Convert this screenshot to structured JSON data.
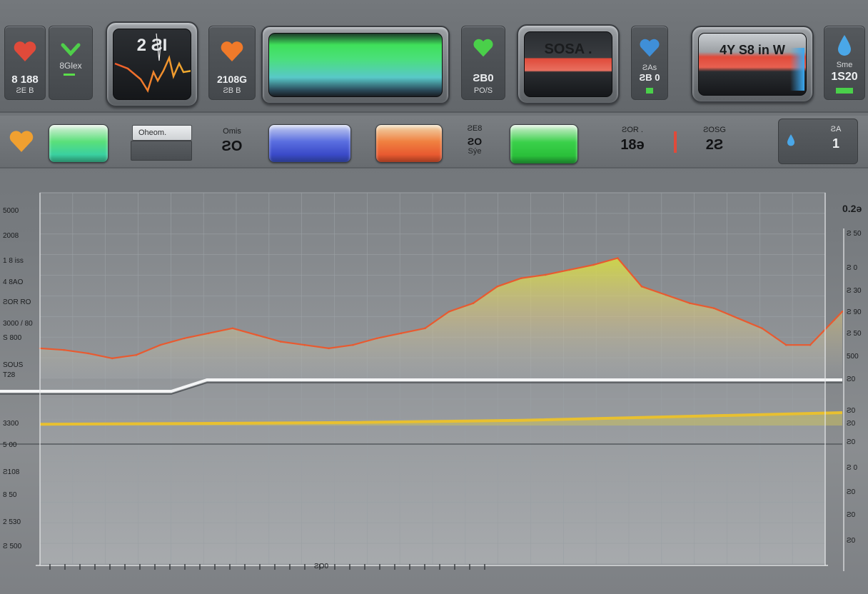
{
  "top": {
    "tiles": [
      {
        "name": "heart",
        "icon": "heart-icon",
        "color": "#e04a3a",
        "value": "8 188",
        "sub": "ƧE B"
      },
      {
        "name": "check",
        "icon": "checkmark-icon",
        "color": "#4fcf4a",
        "value": "",
        "sub": "8Glex"
      },
      {
        "name": "heart-orange",
        "icon": "heart-icon",
        "color": "#f07a2a",
        "value": "2108G",
        "sub": "ƧB B"
      },
      {
        "name": "heart-green",
        "icon": "heart-icon",
        "color": "#4ad04a",
        "value": "ƧB0",
        "sub": "PO/S"
      },
      {
        "name": "heart-blue",
        "icon": "heart-icon",
        "color": "#3f8fd8",
        "value": "ƧB 0",
        "sub": "ƧAs"
      },
      {
        "name": "drop-blue",
        "icon": "drop-icon",
        "color": "#4aa7e8",
        "value": "1S20",
        "sub": "Sme"
      }
    ],
    "screens": {
      "ecg": "2 ƧI",
      "sosa": "SOSA .",
      "right": "4Y S8 in W"
    }
  },
  "mid": {
    "input_value": "Oheom.",
    "cells": [
      {
        "a": "Omis",
        "b": "ƧO",
        "c": ""
      },
      {
        "a": "ƧE8",
        "b": "ƧO",
        "c": "Sýe"
      },
      {
        "a": "ƧOR .",
        "b": "18ə",
        "c": ""
      },
      {
        "a": "ƧOSG",
        "b": "2Ƨ",
        "c": ""
      },
      {
        "a": "ƧA",
        "b": "1",
        "c": ""
      }
    ]
  },
  "chart_data": {
    "type": "area",
    "title": "",
    "top_right_label": "0.2ə",
    "left_ticks": [
      "5000",
      "2008",
      "1 8 iss",
      "4 8AO",
      "ƧOR RO",
      "3000 / 80",
      "S 800",
      "SOUS",
      "T28",
      "3300",
      "5 00",
      "Ƨ108",
      "8 50",
      "2 530",
      "Ƨ 500"
    ],
    "right_ticks": [
      "Ƨ 50",
      "Ƨ 0",
      "Ƨ 30",
      "Ƨ 90",
      "Ƨ 50",
      "500",
      "Ƨ0",
      "Ƨ0",
      "Ƨ0",
      "Ƨ0",
      "Ƨ 0",
      "Ƨ0",
      "Ƨ0",
      "Ƨ0"
    ],
    "bottom_label": "ƧO0",
    "main_series": {
      "name": "",
      "x": [
        0,
        3,
        6,
        9,
        12,
        15,
        18,
        21,
        24,
        27,
        30,
        33,
        36,
        39,
        42,
        45,
        48,
        51,
        54,
        57,
        60,
        63,
        66,
        69,
        72,
        75,
        78,
        81,
        84,
        87,
        90,
        93,
        96,
        99,
        100
      ],
      "y": [
        0.18,
        0.17,
        0.15,
        0.12,
        0.14,
        0.2,
        0.24,
        0.27,
        0.3,
        0.26,
        0.22,
        0.2,
        0.18,
        0.2,
        0.24,
        0.27,
        0.3,
        0.4,
        0.45,
        0.55,
        0.6,
        0.62,
        0.65,
        0.68,
        0.72,
        0.55,
        0.5,
        0.45,
        0.42,
        0.36,
        0.3,
        0.2,
        0.2,
        0.35,
        0.4
      ]
    },
    "lower_series": {
      "name": "",
      "x": [
        0,
        20,
        40,
        60,
        80,
        100
      ],
      "y": [
        0.05,
        0.08,
        0.12,
        0.2,
        0.35,
        0.5
      ]
    },
    "colors": {
      "main": "#e85a30",
      "fill_top": "#d8e040",
      "lower": "#e8c030"
    },
    "grid": true
  }
}
